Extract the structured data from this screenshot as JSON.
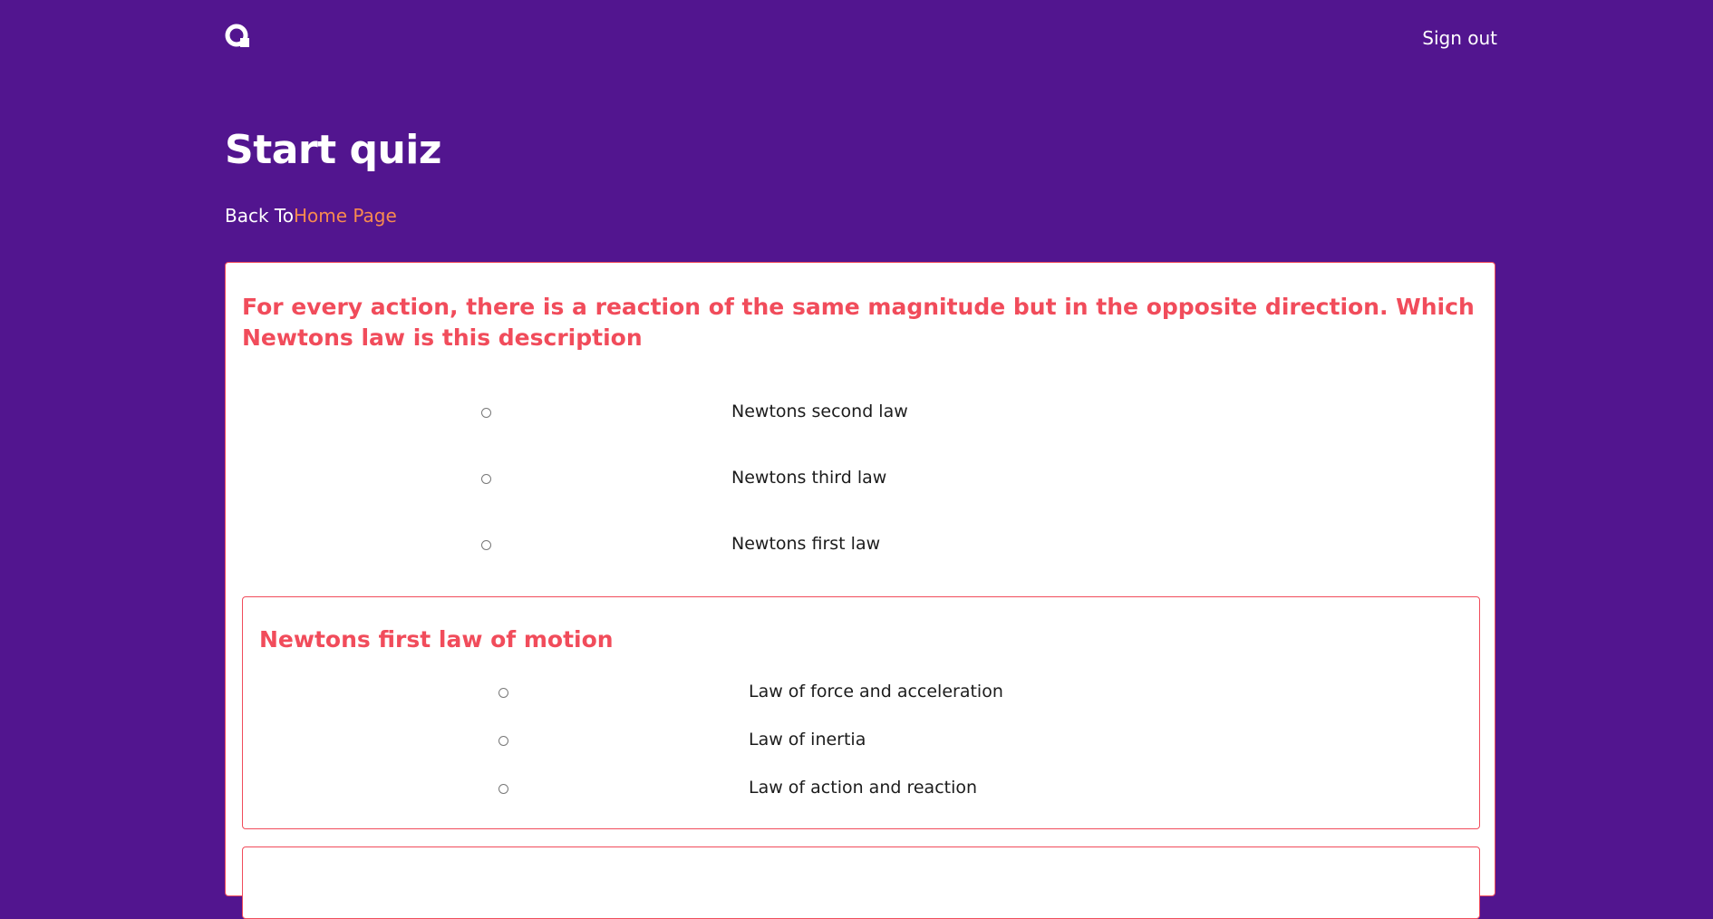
{
  "header": {
    "logo": "quiz-logo-icon",
    "sign_out": "Sign out"
  },
  "page": {
    "title": "Start quiz",
    "back_prefix": "Back To",
    "back_link": "Home Page"
  },
  "questions": [
    {
      "text": "For every action, there is a reaction of the same magnitude but in the opposite direction. Which Newtons law is this description",
      "options": [
        "Newtons second law",
        "Newtons third law",
        "Newtons first law"
      ]
    },
    {
      "text": "Newtons first law of motion",
      "options": [
        "Law of force and acceleration",
        "Law of inertia",
        "Law of action and reaction"
      ]
    }
  ],
  "colors": {
    "background": "#52158f",
    "accent": "#f14c5b",
    "link": "#f88a4f"
  }
}
